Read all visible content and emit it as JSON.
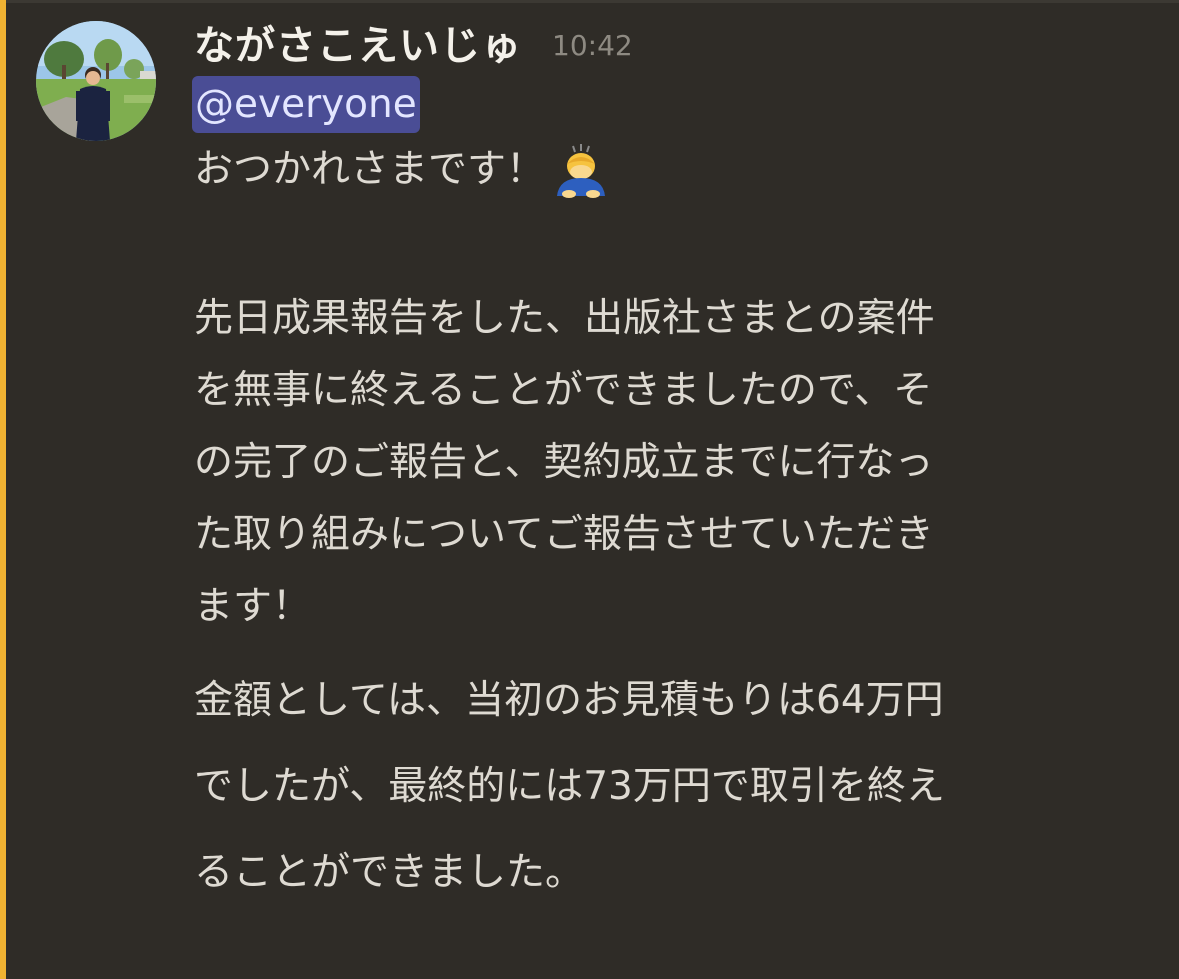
{
  "message": {
    "author": "ながさこえいじゅ",
    "timestamp": "10:42",
    "mention": "@everyone",
    "greeting": "おつかれさまです！",
    "greeting_emoji": "person-bowing-emoji",
    "paragraph1_lines": [
      "先日成果報告をした、出版社さまとの案件",
      "を無事に終えることができましたので、そ",
      "の完了のご報告と、契約成立までに行なっ",
      "た取り組みについてご報告させていただき",
      "ます！"
    ],
    "paragraph2_lines": [
      "金額としては、当初のお見積もりは64万円",
      "でしたが、最終的には73万円で取引を終え",
      "ることができました。"
    ]
  },
  "colors": {
    "background": "#2f2c27",
    "highlight_bar": "#f0b232",
    "mention_bg": "#4a4d95",
    "mention_text": "#e3e6ff",
    "text": "#dedad2",
    "timestamp": "#8e8a82"
  },
  "icons": {
    "avatar": "user-avatar-photo"
  }
}
